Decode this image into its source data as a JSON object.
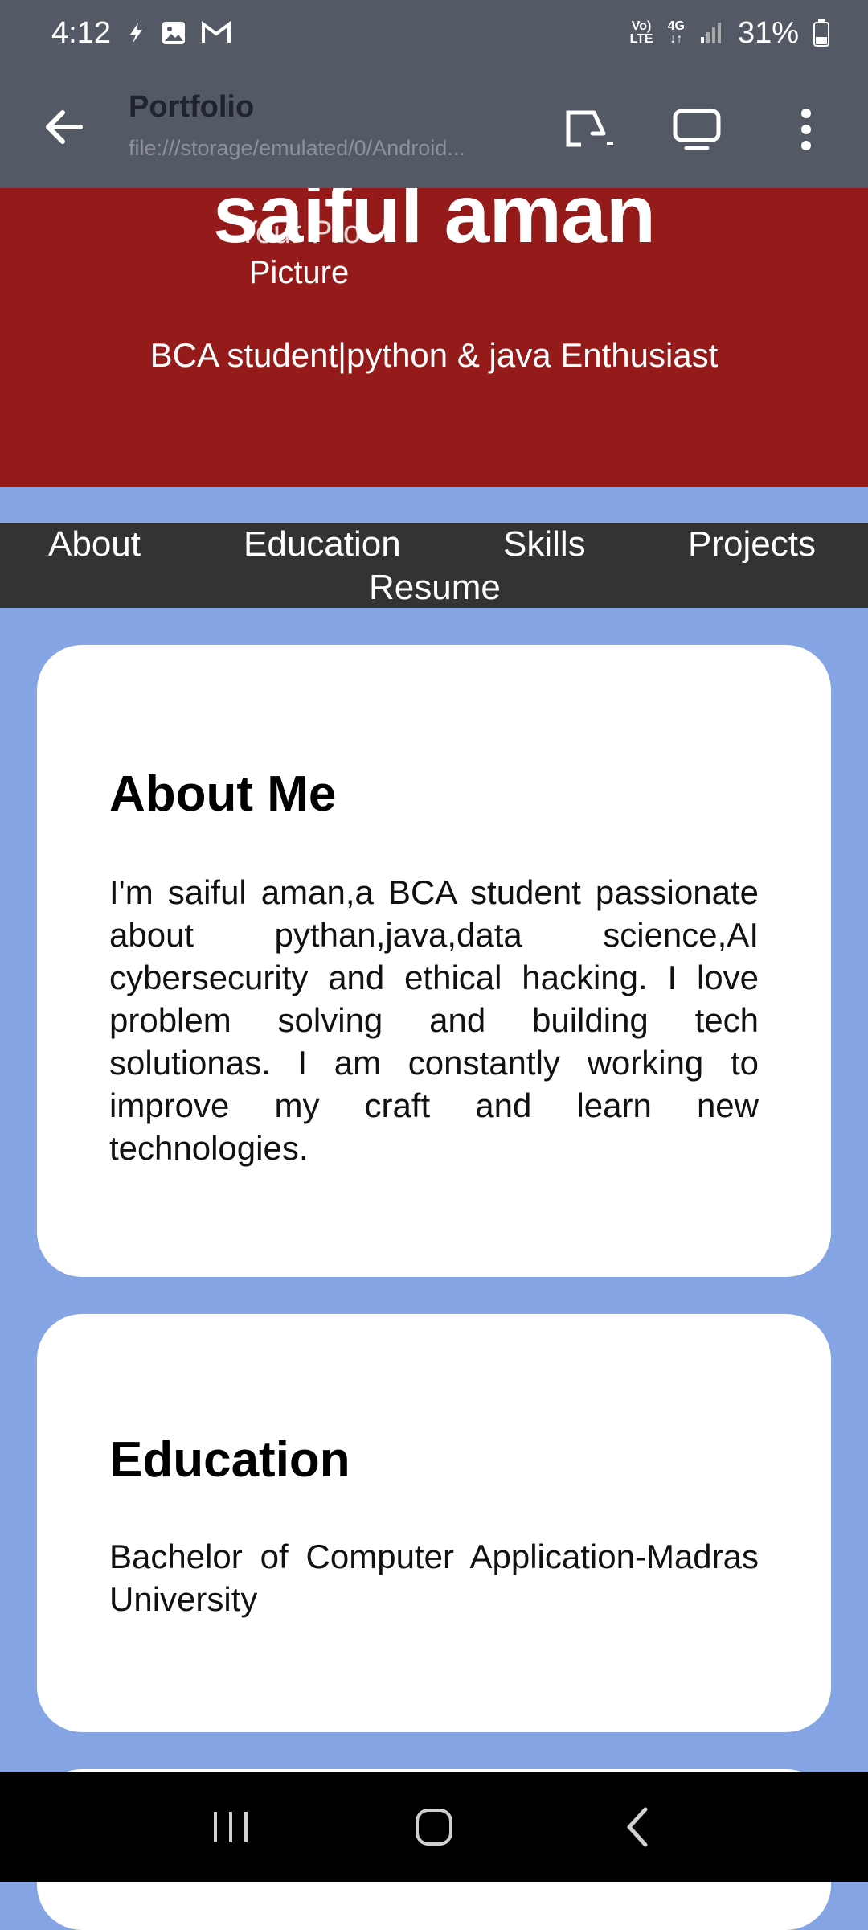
{
  "status_bar": {
    "time": "4:12",
    "network_top": "Vo)",
    "network_bottom": "LTE",
    "signal_top": "4G",
    "signal_bottom": "↓↑",
    "battery": "31%"
  },
  "toolbar": {
    "title": "Portfolio",
    "url": "file:///storage/emulated/0/Android..."
  },
  "hero": {
    "name": "saiful aman",
    "picture_line1": "Your Pro",
    "picture_line2": "Picture",
    "tagline": "BCA student|python & java Enthusiast"
  },
  "nav": {
    "about": "About",
    "education": "Education",
    "skills": "Skills",
    "projects": "Projects",
    "resume": "Resume"
  },
  "about": {
    "heading": "About Me",
    "text": "I'm saiful aman,a BCA student passionate about pythan,java,data science,AI cybersecurity and ethical hacking. I love problem solving and building tech solutionas. I am constantly working to improve my craft and learn new technologies."
  },
  "education": {
    "heading": "Education",
    "text": "Bachelor of Computer Application-Madras University"
  },
  "colors": {
    "hero_bg": "#951b1b",
    "page_bg": "#85a4e4",
    "nav_bg": "#333333",
    "toolbar_bg": "#545966"
  }
}
